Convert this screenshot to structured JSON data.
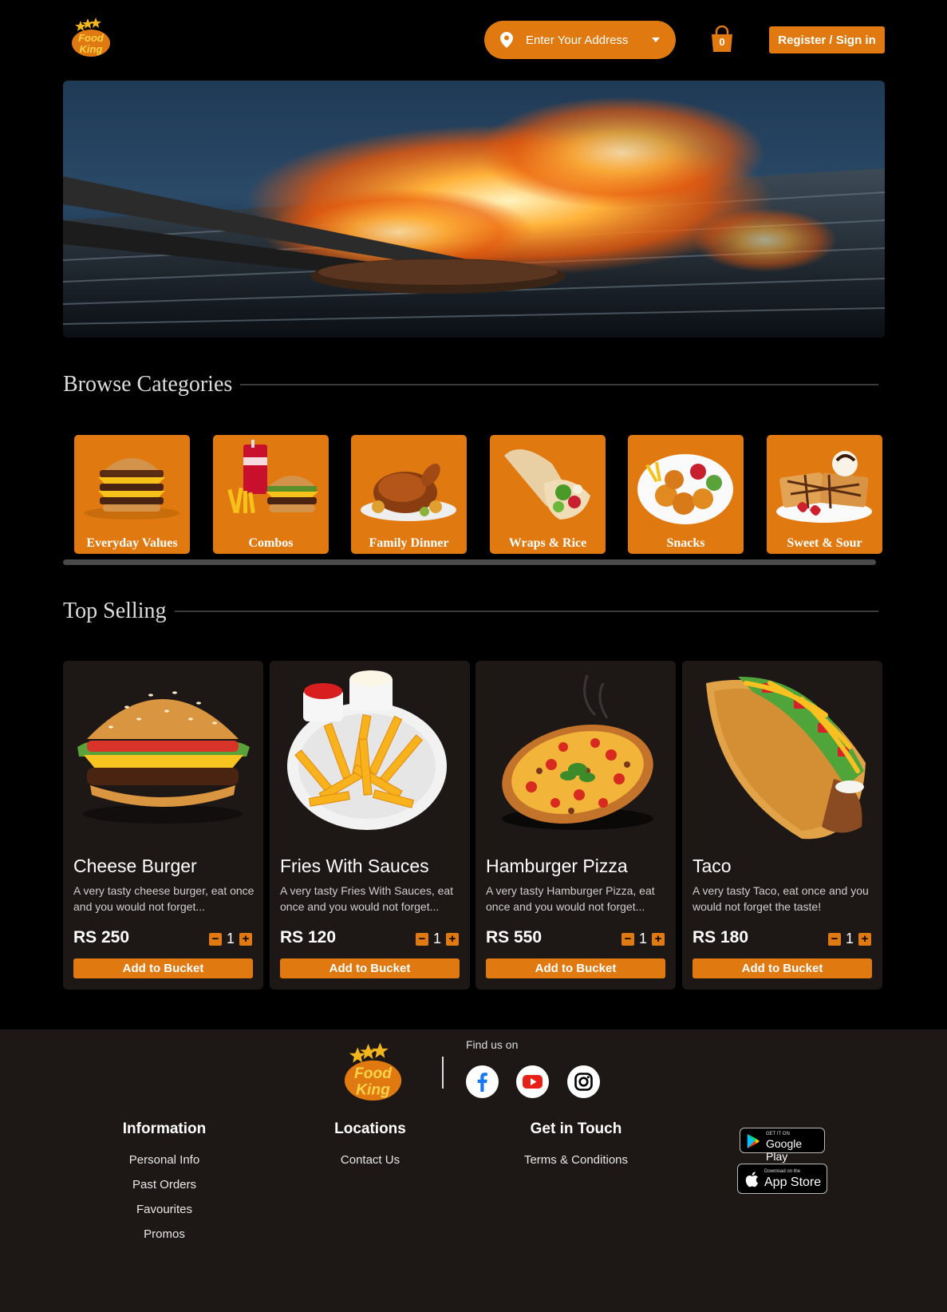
{
  "header": {
    "logo_text": "Food King",
    "address_placeholder": "Enter Your Address",
    "bucket_count": "0",
    "signin_label": "Register / Sign in"
  },
  "sections": {
    "browse_title": "Browse Categories",
    "top_title": "Top Selling"
  },
  "categories": [
    {
      "label": "Everyday Values",
      "icon": "burger-stack-icon"
    },
    {
      "label": "Combos",
      "icon": "combo-meal-icon"
    },
    {
      "label": "Family Dinner",
      "icon": "roast-chicken-icon"
    },
    {
      "label": "Wraps & Rice",
      "icon": "wrap-icon"
    },
    {
      "label": "Snacks",
      "icon": "snack-plate-icon"
    },
    {
      "label": "Sweet & Sour",
      "icon": "waffle-dessert-icon"
    }
  ],
  "products": [
    {
      "name": "Cheese Burger",
      "desc": "A very tasty cheese burger, eat once and you would not forget...",
      "price": "RS 250",
      "qty": "1",
      "add_label": "Add to Bucket"
    },
    {
      "name": "Fries With Sauces",
      "desc": "A very tasty Fries With Sauces, eat once and you would not forget...",
      "price": "RS 120",
      "qty": "1",
      "add_label": "Add to Bucket"
    },
    {
      "name": "Hamburger Pizza",
      "desc": "A very tasty Hamburger Pizza, eat once and you would not forget...",
      "price": "RS 550",
      "qty": "1",
      "add_label": "Add to Bucket"
    },
    {
      "name": "Taco",
      "desc": "A very tasty Taco, eat once and you would not forget the taste!",
      "price": "RS 180",
      "qty": "1",
      "add_label": "Add to Bucket"
    }
  ],
  "qty_controls": {
    "minus": "−",
    "plus": "+"
  },
  "footer": {
    "find_us": "Find us on",
    "information": {
      "title": "Information",
      "links": [
        "Personal Info",
        "Past Orders",
        "Favourites",
        "Promos"
      ]
    },
    "locations": {
      "title": "Locations",
      "links": [
        "Contact Us"
      ]
    },
    "contact": {
      "title": "Get in Touch",
      "links": [
        "Terms & Conditions"
      ]
    },
    "google_play": {
      "small": "GET IT ON",
      "big": "Google Play"
    },
    "app_store": {
      "small": "Download on the",
      "big": "App Store"
    }
  },
  "colors": {
    "accent": "#e07a10",
    "card_bg": "#1d1816",
    "page_bg": "#000000"
  }
}
